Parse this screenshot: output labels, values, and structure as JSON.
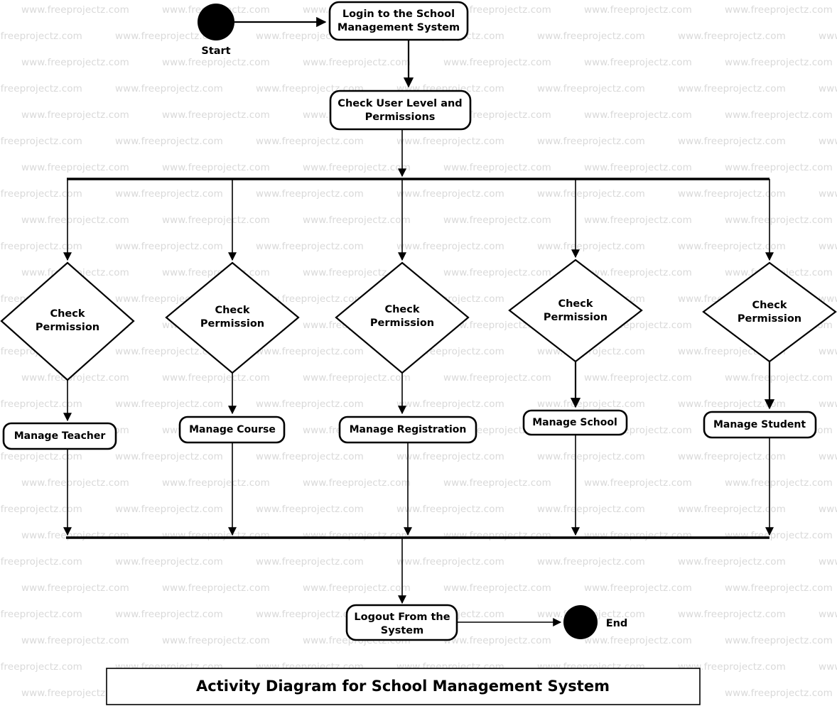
{
  "diagram": {
    "title": "Activity Diagram for School Management System",
    "watermark_text": "www.freeprojectz.com",
    "start_label": "Start",
    "end_label": "End",
    "nodes": {
      "login": "Login to the School Management System",
      "check_user": "Check User Level and Permissions",
      "logout": "Logout From the System"
    },
    "branches": [
      {
        "decision": "Check Permission",
        "activity": "Manage Teacher"
      },
      {
        "decision": "Check Permission",
        "activity": "Manage Course"
      },
      {
        "decision": "Check Permission",
        "activity": "Manage Registration"
      },
      {
        "decision": "Check Permission",
        "activity": "Manage School"
      },
      {
        "decision": "Check Permission",
        "activity": "Manage Student"
      }
    ],
    "lines": {
      "login_l1": "Login to the School",
      "login_l2": "Management System",
      "check_user_l1": "Check User Level and",
      "check_user_l2": "Permissions",
      "logout_l1": "Logout From the",
      "logout_l2": "System",
      "decision_l1": "Check",
      "decision_l2": "Permission"
    },
    "colors": {
      "stroke": "#000000",
      "fill": "#ffffff",
      "watermark": "#d9d9d9"
    }
  }
}
